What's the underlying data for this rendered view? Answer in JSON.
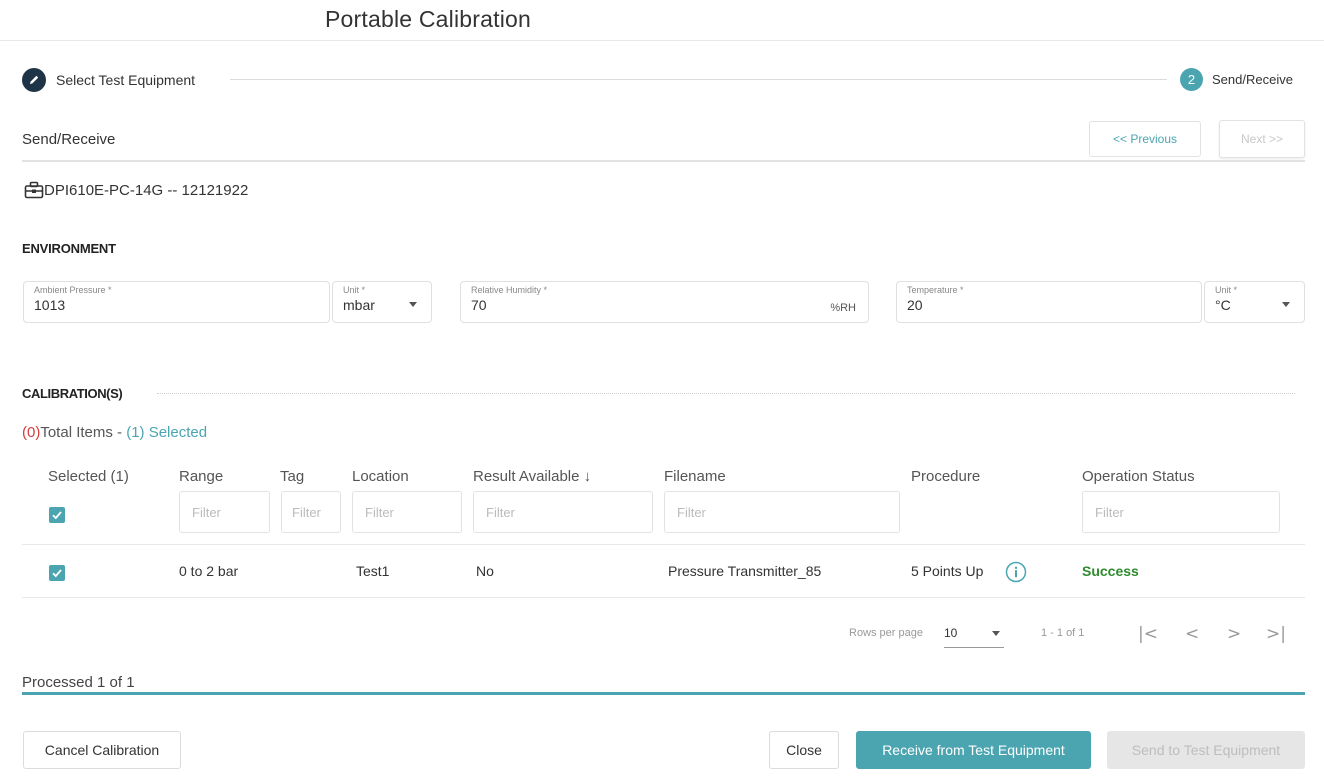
{
  "app": {
    "title": "Portable Calibration"
  },
  "stepper": {
    "step1": {
      "label": "Select Test Equipment",
      "icon": "pencil-icon"
    },
    "step2": {
      "number": "2",
      "label": "Send/Receive"
    }
  },
  "section": {
    "title": "Send/Receive",
    "prev_label": "<< Previous",
    "next_label": "Next >>"
  },
  "device": {
    "name": "DPI610E-PC-14G -- 12121922",
    "icon": "toolbox-icon"
  },
  "environment": {
    "title": "ENVIRONMENT",
    "ambient_pressure": {
      "label": "Ambient Pressure *",
      "value": "1013"
    },
    "pressure_unit": {
      "label": "Unit *",
      "value": "mbar"
    },
    "humidity": {
      "label": "Relative Humidity *",
      "value": "70",
      "suffix": "%RH"
    },
    "temperature": {
      "label": "Temperature *",
      "value": "20"
    },
    "temp_unit": {
      "label": "Unit *",
      "value": "°C"
    }
  },
  "calibrations": {
    "title": "CALIBRATION(S)",
    "total_count": "(0)",
    "total_label": "Total Items - ",
    "selected_count": "(1)",
    "selected_label": " Selected",
    "columns": {
      "selected": "Selected (1)",
      "range": "Range",
      "tag": "Tag",
      "location": "Location",
      "result": "Result Available ↓",
      "filename": "Filename",
      "procedure": "Procedure",
      "status": "Operation Status"
    },
    "filter_placeholder": "Filter",
    "rows": [
      {
        "range": "0 to 2 bar",
        "tag": "",
        "location": "Test1",
        "result": "No",
        "filename": "Pressure Transmitter_85",
        "procedure": "5 Points Up",
        "status": "Success"
      }
    ]
  },
  "pagination": {
    "rows_per_page_label": "Rows per page",
    "rows_per_page": "10",
    "range": "1 - 1 of 1",
    "first": "|<",
    "prev": "<",
    "next": ">",
    "last": ">|"
  },
  "progress": {
    "label": "Processed 1 of 1",
    "fraction": 1.0
  },
  "footer": {
    "cancel": "Cancel Calibration",
    "close": "Close",
    "receive": "Receive from Test Equipment",
    "send": "Send to Test Equipment"
  },
  "colors": {
    "accent": "#4aa5b0",
    "dark": "#1f3447",
    "success": "#2e8b2e",
    "error": "#d63c3c"
  }
}
